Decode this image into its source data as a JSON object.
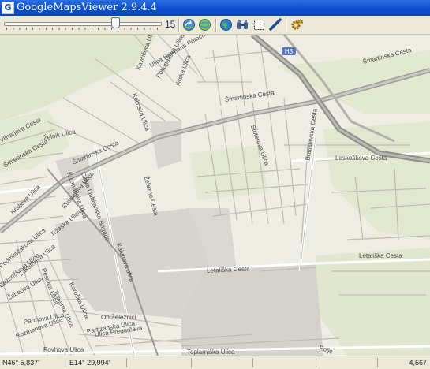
{
  "window": {
    "title": "GoogleMapsViewer 2.9.4.4",
    "app_icon_letter": "G"
  },
  "toolbar": {
    "zoom_value": "15",
    "zoom_fraction": 0.71,
    "buttons": [
      {
        "name": "reload-map-icon"
      },
      {
        "name": "globe-icon"
      },
      {
        "name": "earth-view-icon"
      },
      {
        "name": "binoculars-icon"
      },
      {
        "name": "select-rectangle-icon"
      },
      {
        "name": "measure-ruler-icon"
      },
      {
        "name": "settings-gear-icon"
      }
    ]
  },
  "map": {
    "labels": {
      "smartinska_1": "Šmartinska Cesta",
      "smartinska_2": "Šmartinska Cesta",
      "smartinska_3": "Šmartinska Cesta",
      "smartinska_4": "Šmartinska Cesta",
      "leskoskova": "Leskoškova Cesta",
      "letaliska_1": "Letališka Cesta",
      "letaliska_2": "Letališka Cesta",
      "kajuhova": "Kajuhova ulica",
      "zelezna": "Železna Cesta",
      "bratislavska": "Bratislavska Cesta",
      "zelenik": "Želnik Ulica",
      "ob_zeleznici": "Ob Železnici",
      "toplarniska": "Toplarniška Ulica",
      "partizanska": "Partizanska Ulica",
      "rusjanova": "Rusjanova Ulica",
      "kuzmanova": "Kuzmanova Ulica",
      "cesta_ljubljanske": "Cesta Ljubljanske Brigade",
      "hermanova": "Ulica Hermana Potočnika",
      "kolinska": "Kolinska Ulica",
      "pokopaliska": "Pokopališka Ulica",
      "ilirska": "Ilirska Ulica",
      "kavciceva": "Kavčičeva Ulica",
      "pesnica": "Pesnica Ulica",
      "trzaska": "Tržaška Ulica",
      "polje": "Polje",
      "vilharjeva": "Vilharjeva Cesta",
      "stoterova": "Stoterova Ulica",
      "kraljeva": "Kraljeva Ulica",
      "ulica_pregarceva": "Ulica Pregarčeva",
      "parmova": "Parmova Ulica",
      "podmilscakova": "Podmilščakova Ulica",
      "zabeova": "Žabeova Ulica",
      "bezenskova": "Beženškova Ulica",
      "toplarna": "Toplarna Ulica",
      "koroska": "Koroška Ulica",
      "zakotnova": "Zakotnova Ulica",
      "povhova": "Povhova Ulica",
      "rozmanova": "Rozmanova Ulica"
    },
    "highway_shield": "H3"
  },
  "status": {
    "latitude": "N46° 5,837'",
    "longitude": "E14° 29,994'",
    "scale": "4,567"
  }
}
